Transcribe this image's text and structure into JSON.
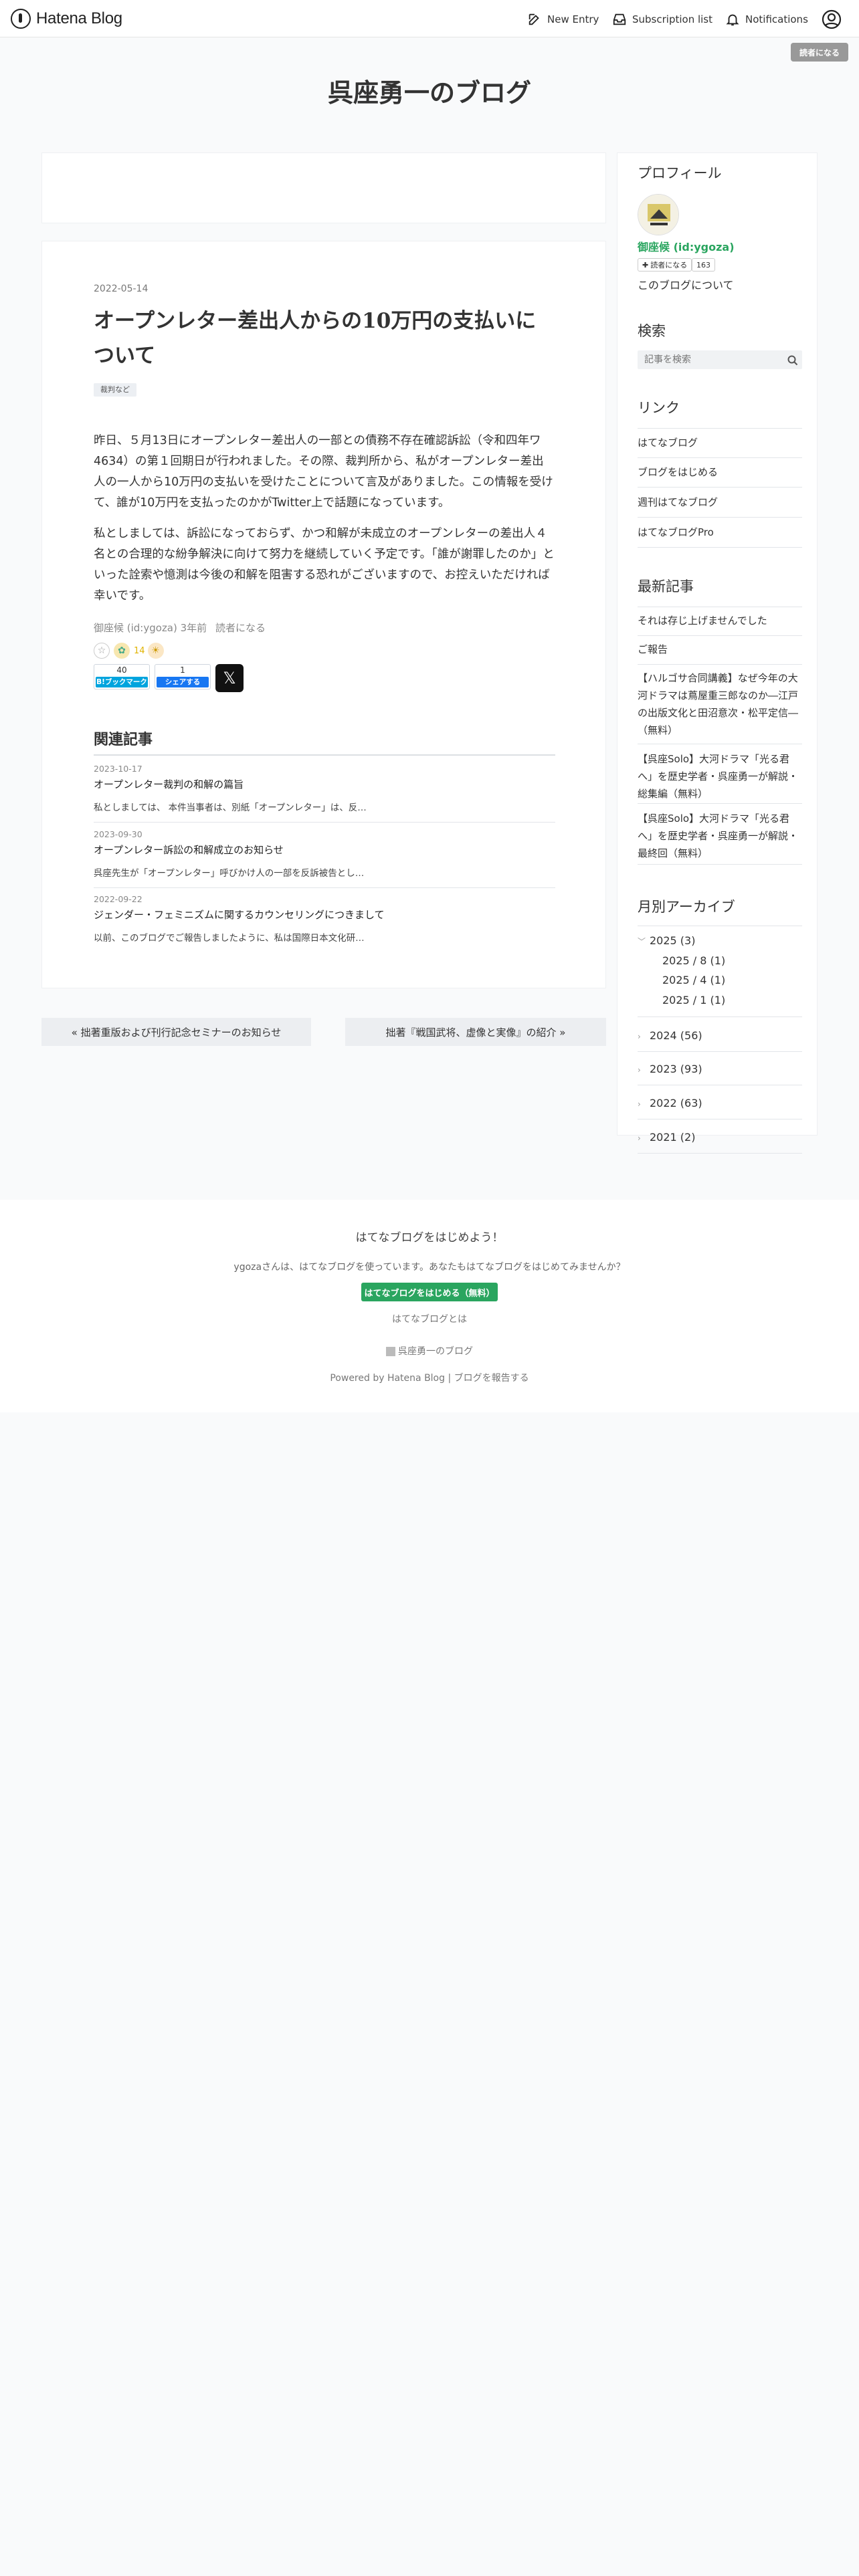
{
  "header": {
    "logo_text": "Hatena Blog",
    "new_entry": "New Entry",
    "subscription_list": "Subscription list",
    "notifications": "Notifications",
    "reader_button": "読者になる"
  },
  "blog": {
    "title": "呉座勇一のブログ"
  },
  "entry": {
    "date": "2022-05-14",
    "title": "オープンレター差出人からの10万円の支払いについて",
    "category": "裁判など",
    "paragraphs": [
      "昨日、５月13日にオープンレター差出人の一部との債務不存在確認訴訟（令和四年ワ4634）の第１回期日が行われました。その際、裁判所から、私がオープンレター差出人の一人から10万円の支払いを受けたことについて言及がありました。この情報を受けて、誰が10万円を支払ったのかがTwitter上で話題になっています。",
      "私としましては、訴訟になっておらず、かつ和解が未成立のオープンレターの差出人４名との合理的な紛争解決に向けて努力を継続していく予定です。「誰が謝罪したのか」といった詮索や憶測は今後の和解を阻害する恐れがございますので、お控えいただければ幸いです。"
    ],
    "footer_author": "御座候 (id:ygoza)",
    "footer_time": "3年前",
    "footer_reader": "読者になる",
    "star_count": "14",
    "bookmark_count": "40",
    "bookmark_label": "B!ブックマーク",
    "facebook_count": "1",
    "facebook_label": "シェアする",
    "x_label": "𝕏"
  },
  "related": {
    "heading": "関連記事",
    "items": [
      {
        "date": "2023-10-17",
        "title": "オープンレター裁判の和解の篇旨",
        "excerpt": "私としましては、 本件当事者は、別紙「オープンレター」は、反…"
      },
      {
        "date": "2023-09-30",
        "title": "オープンレター訴訟の和解成立のお知らせ",
        "excerpt": "呉座先生が「オープンレター」呼びかけ人の一部を反訴被告とし…"
      },
      {
        "date": "2022-09-22",
        "title": "ジェンダー・フェミニズムに関するカウンセリングにつきまして",
        "excerpt": "以前、このブログでご報告しましたように、私は国際日本文化研…"
      }
    ]
  },
  "pager": {
    "prev": "« 拙著重版および刊行記念セミナーのお知らせ",
    "next": "拙著『戦国武将、虚像と実像』の紹介 »"
  },
  "sidebar": {
    "profile": {
      "heading": "プロフィール",
      "name": "御座候 (id:ygoza)",
      "reader_button": "読者になる",
      "reader_count": "163",
      "about": "このブログについて"
    },
    "search": {
      "heading": "検索",
      "placeholder": "記事を検索"
    },
    "links": {
      "heading": "リンク",
      "items": [
        "はてなブログ",
        "ブログをはじめる",
        "週刊はてなブログ",
        "はてなブログPro"
      ]
    },
    "recent": {
      "heading": "最新記事",
      "items": [
        "それは存じ上げませんでした",
        "ご報告",
        "【ハルゴサ合同講義】なぜ今年の大河ドラマは蔦屋重三郎なのか―江戸の出版文化と田沼意次・松平定信―（無料）",
        "【呉座Solo】大河ドラマ「光る君へ」を歴史学者・呉座勇一が解説・総集編（無料）",
        "【呉座Solo】大河ドラマ「光る君へ」を歴史学者・呉座勇一が解説・最終回（無料）"
      ]
    },
    "archive": {
      "heading": "月別アーカイブ",
      "years": [
        {
          "label": "2025 (3)",
          "expanded": true,
          "months": [
            "2025 / 8 (1)",
            "2025 / 4 (1)",
            "2025 / 1 (1)"
          ]
        },
        {
          "label": "2024 (56)",
          "expanded": false
        },
        {
          "label": "2023 (93)",
          "expanded": false
        },
        {
          "label": "2022 (63)",
          "expanded": false
        },
        {
          "label": "2021 (2)",
          "expanded": false
        }
      ]
    }
  },
  "footer": {
    "heading": "はてなブログをはじめよう！",
    "description": "ygozaさんは、はてなブログを使っています。あなたもはてなブログをはじめてみませんか？",
    "start_button": "はてなブログをはじめる（無料）",
    "about_link": "はてなブログとは",
    "blog_link": "呉座勇一のブログ",
    "powered_by": "Powered by Hatena Blog",
    "separator": "|",
    "report": "ブログを報告する"
  },
  "colors": {
    "accent_green": "#2aa55f",
    "bookmark_blue": "#00a4de",
    "facebook_blue": "#1877f2"
  }
}
